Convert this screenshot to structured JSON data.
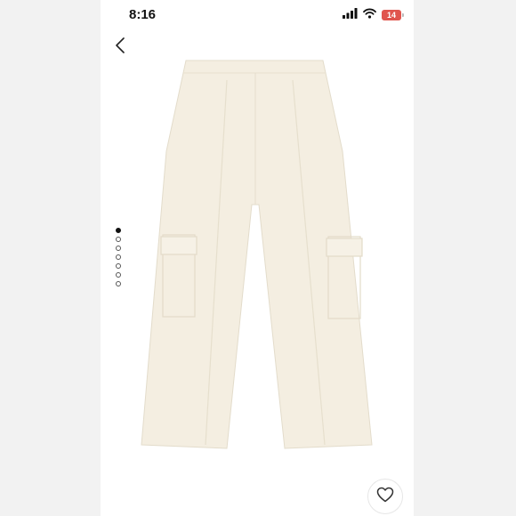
{
  "status_bar": {
    "time": "8:16",
    "battery_level": "14",
    "icons": [
      "signal-icon",
      "wifi-icon",
      "battery-icon"
    ]
  },
  "nav": {
    "back_icon": "chevron-left-icon"
  },
  "gallery": {
    "image_count": 7,
    "active_index": 0,
    "product_color": "#f4eee1"
  },
  "actions": {
    "like_icon": "heart-icon"
  }
}
